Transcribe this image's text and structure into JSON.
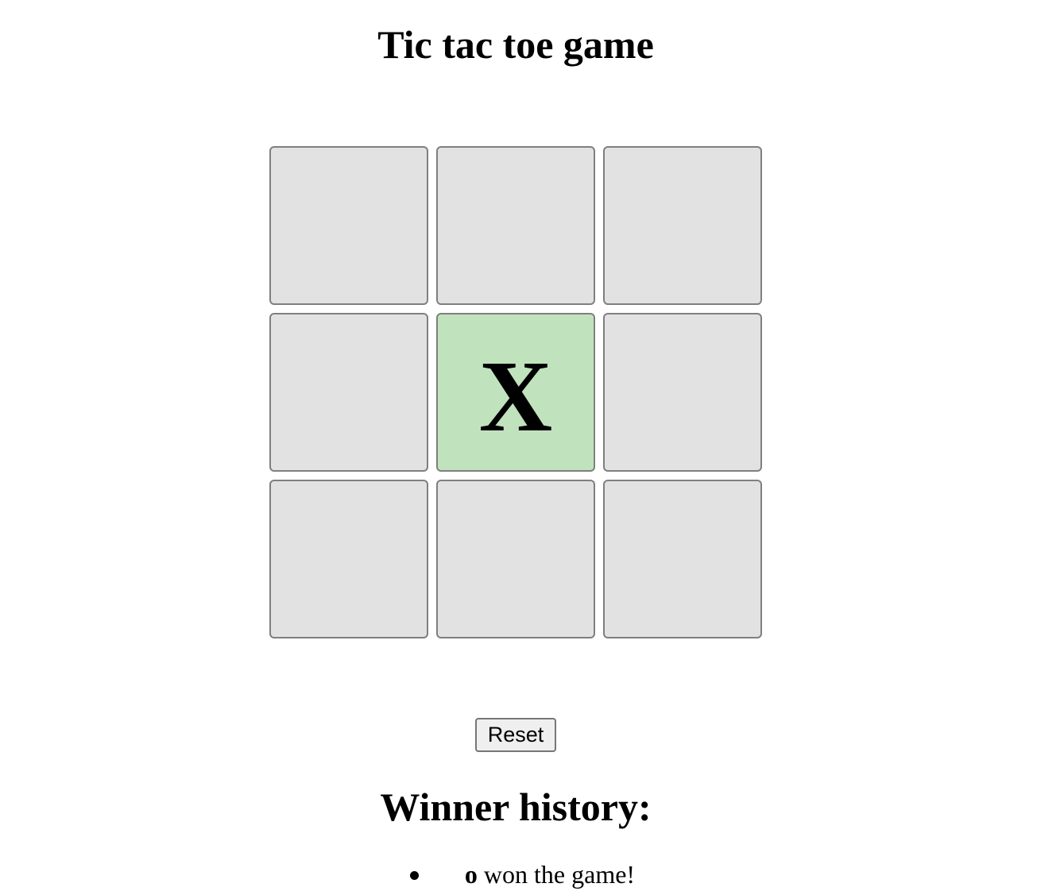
{
  "title": "Tic tac toe game",
  "board": {
    "cells": [
      "",
      "",
      "",
      "",
      "X",
      "",
      "",
      "",
      ""
    ],
    "highlighted_cell": 4,
    "highlight_color": "#c0e3bd",
    "cell_color": "#e2e2e2"
  },
  "reset_label": "Reset",
  "history": {
    "title": "Winner history:",
    "entries": [
      {
        "winner": "o",
        "text": " won the game!"
      }
    ]
  }
}
